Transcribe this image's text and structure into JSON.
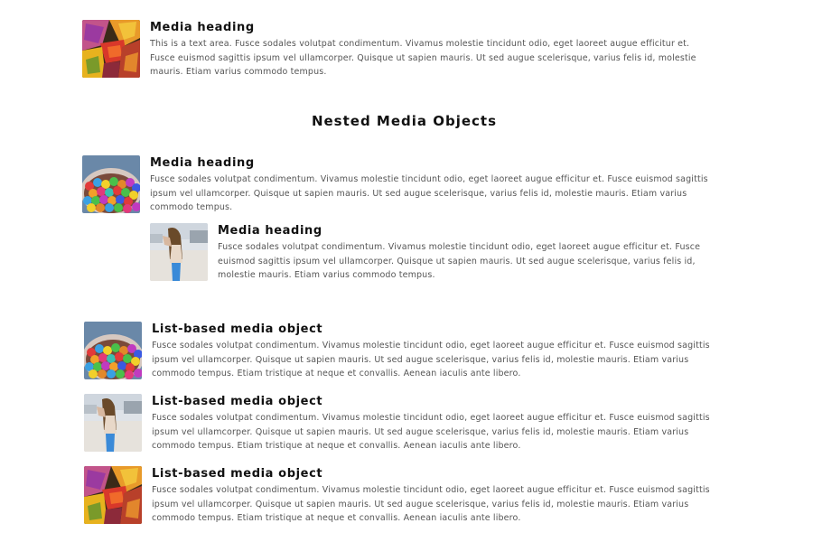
{
  "top": {
    "heading": "Media heading",
    "text": "This is a text area. Fusce sodales volutpat condimentum. Vivamus molestie tincidunt odio, eget laoreet augue efficitur et. Fusce euismod sagittis ipsum vel ullamcorper. Quisque ut sapien mauris. Ut sed augue scelerisque, varius felis id, molestie mauris. Etiam varius commodo tempus.",
    "image": "autumn-leaves-image"
  },
  "nested": {
    "title": "Nested Media Objects",
    "outer": {
      "heading": "Media heading",
      "text": "Fusce sodales volutpat condimentum. Vivamus molestie tincidunt odio, eget laoreet augue efficitur et. Fusce euismod sagittis ipsum vel ullamcorper. Quisque ut sapien mauris. Ut sed augue scelerisque, varius felis id, molestie mauris. Etiam varius commodo tempus.",
      "image": "candy-bowl-image"
    },
    "inner": {
      "heading": "Media heading",
      "text": "Fusce sodales volutpat condimentum. Vivamus molestie tincidunt odio, eget laoreet augue efficitur et. Fusce euismod sagittis ipsum vel ullamcorper. Quisque ut sapien mauris. Ut sed augue scelerisque, varius felis id, molestie mauris. Etiam varius commodo tempus.",
      "image": "woman-beach-image"
    }
  },
  "list": [
    {
      "heading": "List-based media object",
      "text": "Fusce sodales volutpat condimentum. Vivamus molestie tincidunt odio, eget laoreet augue efficitur et. Fusce euismod sagittis ipsum vel ullamcorper. Quisque ut sapien mauris. Ut sed augue scelerisque, varius felis id, molestie mauris. Etiam varius commodo tempus. Etiam tristique at neque et convallis. Aenean iaculis ante libero.",
      "image": "candy-bowl-image"
    },
    {
      "heading": "List-based media object",
      "text": "Fusce sodales volutpat condimentum. Vivamus molestie tincidunt odio, eget laoreet augue efficitur et. Fusce euismod sagittis ipsum vel ullamcorper. Quisque ut sapien mauris. Ut sed augue scelerisque, varius felis id, molestie mauris. Etiam varius commodo tempus. Etiam tristique at neque et convallis. Aenean iaculis ante libero.",
      "image": "woman-beach-image"
    },
    {
      "heading": "List-based media object",
      "text": "Fusce sodales volutpat condimentum. Vivamus molestie tincidunt odio, eget laoreet augue efficitur et. Fusce euismod sagittis ipsum vel ullamcorper. Quisque ut sapien mauris. Ut sed augue scelerisque, varius felis id, molestie mauris. Etiam varius commodo tempus. Etiam tristique at neque et convallis. Aenean iaculis ante libero.",
      "image": "autumn-leaves-image"
    }
  ]
}
